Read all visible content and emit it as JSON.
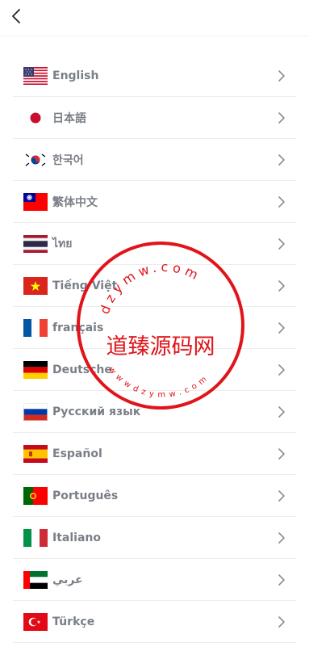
{
  "header": {
    "back_icon": "chevron-left-icon"
  },
  "languages": [
    {
      "label": "English",
      "flag": "flag-us-icon"
    },
    {
      "label": "日本語",
      "flag": "flag-jp-icon"
    },
    {
      "label": "한국어",
      "flag": "flag-kr-icon"
    },
    {
      "label": "繁体中文",
      "flag": "flag-tw-icon"
    },
    {
      "label": "ไทย",
      "flag": "flag-th-icon"
    },
    {
      "label": "Tiếng Việt",
      "flag": "flag-vn-icon"
    },
    {
      "label": "français",
      "flag": "flag-fr-icon"
    },
    {
      "label": "Deutsche",
      "flag": "flag-de-icon"
    },
    {
      "label": "Русский язык",
      "flag": "flag-ru-icon"
    },
    {
      "label": "Español",
      "flag": "flag-es-icon"
    },
    {
      "label": "Português",
      "flag": "flag-pt-icon"
    },
    {
      "label": "Italiano",
      "flag": "flag-it-icon"
    },
    {
      "label": "عربي",
      "flag": "flag-ae-icon"
    },
    {
      "label": "Türkçe",
      "flag": "flag-tr-icon"
    }
  ],
  "watermark": {
    "ring_text": "dzymw.com",
    "center_text": "道臻源码网",
    "bottom_text": "wwwdzymw.com",
    "color": "#e0151b"
  }
}
